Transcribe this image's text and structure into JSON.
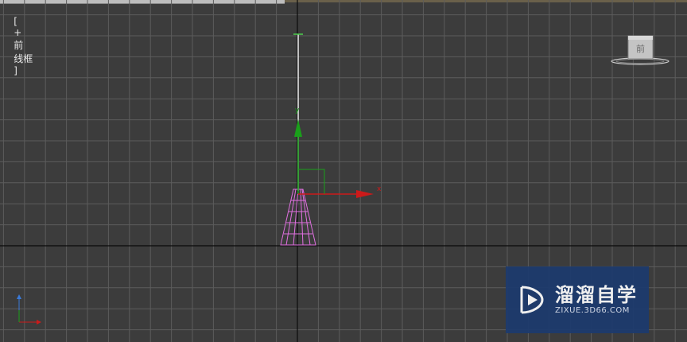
{
  "viewport": {
    "label_open": "[",
    "label_plus": "+",
    "label_view": "前",
    "label_shading": "线框",
    "label_close": "]"
  },
  "viewcube": {
    "face_label": "前"
  },
  "gizmo": {
    "x_label": "x",
    "y_label": "y"
  },
  "watermark": {
    "title": "溜溜自学",
    "subtitle": "ZIXUE.3D66.COM"
  },
  "colors": {
    "background": "#3c3c3c",
    "grid_line": "#5c5c5c",
    "axis_line": "#0a0a0a",
    "object_wire": "#e070e0",
    "gizmo_x": "#cc1a1a",
    "gizmo_y": "#1aa01a",
    "watermark_bg": "#1c3a6e"
  }
}
